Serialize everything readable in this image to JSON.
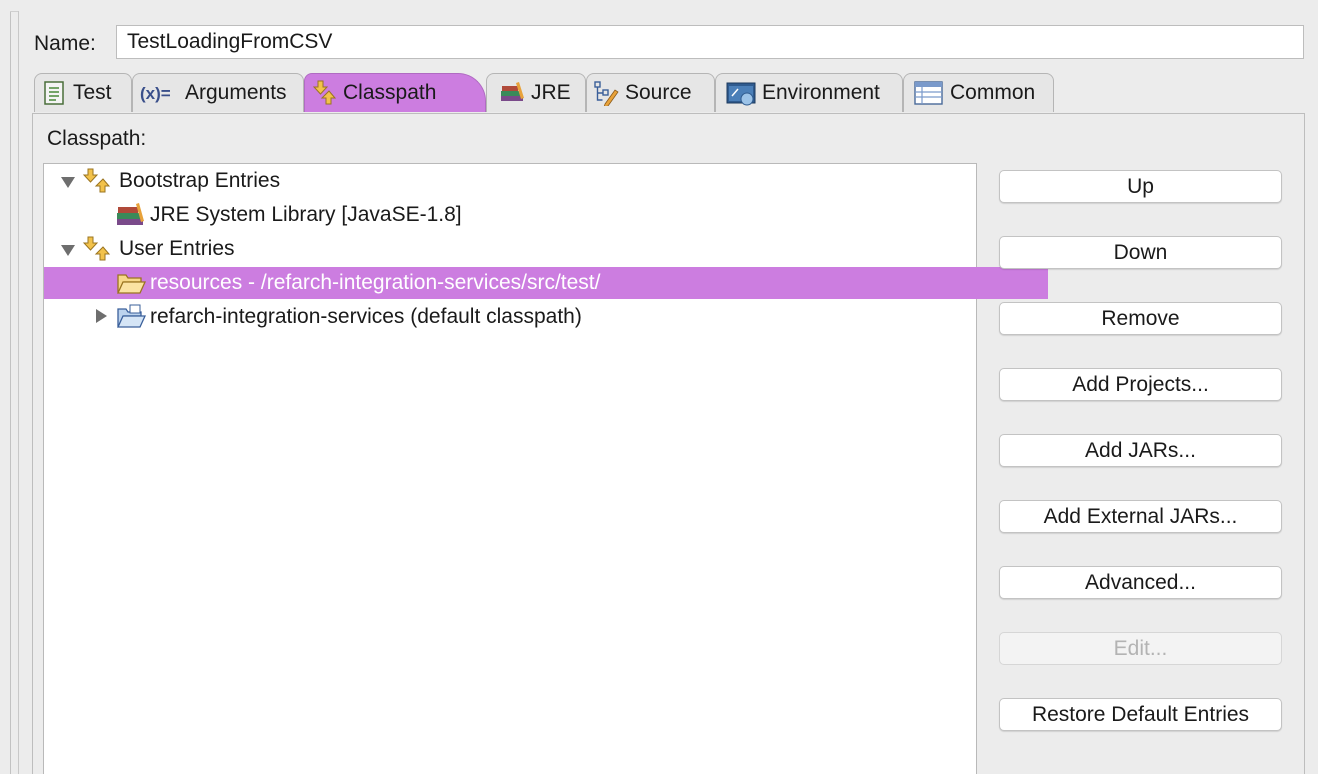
{
  "name": {
    "label": "Name:",
    "value": "TestLoadingFromCSV"
  },
  "tabs": [
    {
      "label": "Test",
      "icon": "test-icon",
      "active": false
    },
    {
      "label": "Arguments",
      "icon": "arguments-icon",
      "active": false
    },
    {
      "label": "Classpath",
      "icon": "classpath-icon",
      "active": true
    },
    {
      "label": "JRE",
      "icon": "jre-library-icon",
      "active": false
    },
    {
      "label": "Source",
      "icon": "source-icon",
      "active": false
    },
    {
      "label": "Environment",
      "icon": "environment-icon",
      "active": false
    },
    {
      "label": "Common",
      "icon": "common-icon",
      "active": false
    }
  ],
  "classpath": {
    "label": "Classpath:",
    "tree": [
      {
        "label": "Bootstrap Entries",
        "icon": "classpath-entries-icon",
        "expanded": true
      },
      {
        "label": "JRE System Library [JavaSE-1.8]",
        "icon": "jre-library-icon"
      },
      {
        "label": "User Entries",
        "icon": "classpath-entries-icon",
        "expanded": true
      },
      {
        "label": "resources - /refarch-integration-services/src/test/",
        "icon": "folder-open-icon",
        "selected": true
      },
      {
        "label": "refarch-integration-services (default classpath)",
        "icon": "project-folder-icon",
        "expanded": false
      }
    ]
  },
  "buttons": {
    "up": "Up",
    "down": "Down",
    "remove": "Remove",
    "add_projects": "Add Projects...",
    "add_jars": "Add JARs...",
    "add_external_jars": "Add External JARs...",
    "advanced": "Advanced...",
    "edit": "Edit...",
    "restore_default": "Restore Default Entries"
  },
  "colors": {
    "selection": "#cc7de0",
    "background": "#ececec"
  }
}
